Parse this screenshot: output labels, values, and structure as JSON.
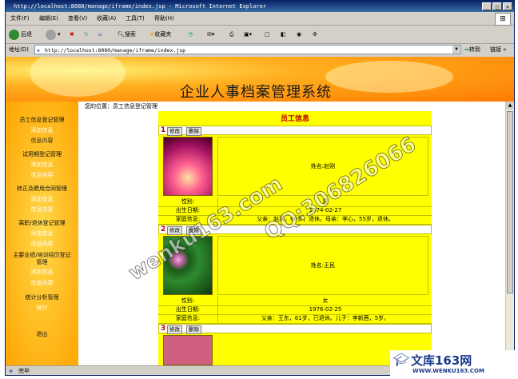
{
  "window": {
    "title": "http://localhost:8080/manage/iframe/index.jsp - Microsoft Internet Explorer"
  },
  "menu": [
    "文件(F)",
    "编辑(E)",
    "查看(V)",
    "收藏(A)",
    "工具(T)",
    "帮助(H)"
  ],
  "toolbar": {
    "back": "后退",
    "search": "搜索",
    "favorites": "收藏夹"
  },
  "address": {
    "label": "地址(D)",
    "url": "http://localhost:8080/manage/iframe/index.jsp",
    "go": "转到",
    "links": "链接 »"
  },
  "banner": {
    "title": "企业人事档案管理系统"
  },
  "sidebar": {
    "groups": [
      {
        "title": "员工信息登记管理",
        "items": [
          "添加信息",
          "信息内容"
        ]
      },
      {
        "title": "试用期登记管理",
        "items": [
          "添加信息",
          "信息内容"
        ]
      },
      {
        "title": "转正及聘用合同管理",
        "items": [
          "添加信息",
          "信息内容"
        ]
      },
      {
        "title": "离职/退休登记管理",
        "items": [
          "添加信息",
          "信息内容"
        ]
      },
      {
        "title": "主要业绩/培训经历登记管理",
        "items": [
          "添加信息",
          "信息内容"
        ]
      },
      {
        "title": "统计分析管理",
        "items": [
          "统计"
        ]
      }
    ],
    "logout": "退出"
  },
  "breadcrumb": "您的位置：员工信息登记管理",
  "panel": {
    "title": "员工信息",
    "edit_label": "修改",
    "delete_label": "删除",
    "field_labels": {
      "gender": "性别:",
      "birth": "出生日期:",
      "family": "家庭信息:"
    },
    "records": [
      {
        "num": "1",
        "name": "姓名:赵刚",
        "gender": "男",
        "birth": "1974-02-27",
        "family": "父亲：赵某，60岁，退休。母亲：李心，55岁，退休。"
      },
      {
        "num": "2",
        "name": "姓名:王民",
        "gender": "女",
        "birth": "1976-02-25",
        "family": "父亲：王东，61岁，已退休。儿子：李新茜，5岁。"
      },
      {
        "num": "3"
      }
    ]
  },
  "watermarks": [
    "wenku163.com",
    "QQ:306826066"
  ],
  "status": "完毕",
  "logo": {
    "brand": "文库163网",
    "url": "WWW.WENKU163.COM"
  },
  "colors": {
    "panel": "#ffff00",
    "title_red": "#c00000",
    "sidebar": "#ffb000"
  }
}
